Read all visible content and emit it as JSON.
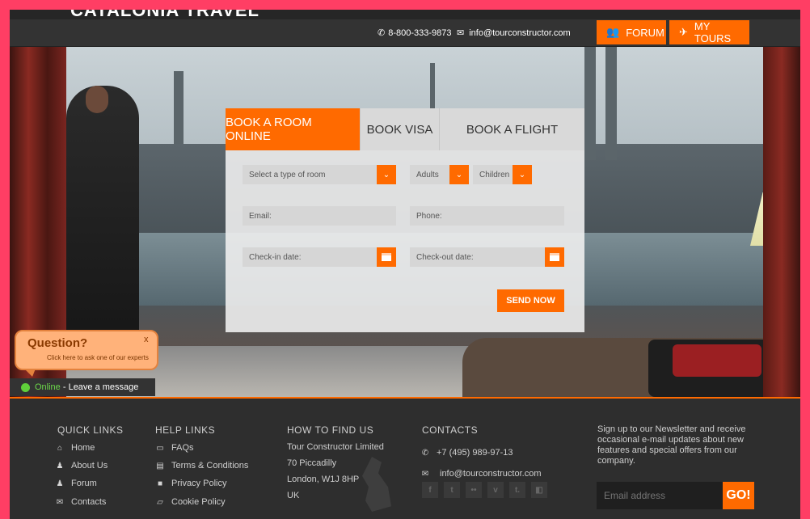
{
  "header": {
    "logo_text": "CATALONIA TRAVEL",
    "phone": "8-800-333-9873",
    "email": "info@tourconstructor.com",
    "forum_label": "FORUM",
    "tours_label": "MY TOURS"
  },
  "booking": {
    "tabs": [
      {
        "label": "BOOK A ROOM ONLINE",
        "active": true
      },
      {
        "label": "BOOK VISA",
        "active": false
      },
      {
        "label": "BOOK A FLIGHT",
        "active": false
      }
    ],
    "room_type_placeholder": "Select a type of room",
    "adults_placeholder": "Adults",
    "children_placeholder": "Children",
    "email_placeholder": "Email:",
    "phone_placeholder": "Phone:",
    "checkin_placeholder": "Check-in date:",
    "checkout_placeholder": "Check-out date:",
    "send_label": "SEND NOW"
  },
  "chat": {
    "question_title": "Question?",
    "close_label": "x",
    "question_sub": "Click here to ask one of our experts",
    "online_label": "Online",
    "leave_message": " - Leave a message"
  },
  "footer": {
    "quick_links": {
      "title": "QUICK LINKS",
      "items": [
        {
          "label": "Home",
          "icon": "home-icon"
        },
        {
          "label": "About Us",
          "icon": "user-icon"
        },
        {
          "label": "Forum",
          "icon": "users-icon"
        },
        {
          "label": "Contacts",
          "icon": "mail-icon"
        }
      ]
    },
    "help_links": {
      "title": "HELP LINKS",
      "items": [
        {
          "label": "FAQs",
          "icon": "chat-icon"
        },
        {
          "label": "Terms & Conditions",
          "icon": "document-icon"
        },
        {
          "label": "Privacy Policy",
          "icon": "lock-icon"
        },
        {
          "label": "Cookie Policy",
          "icon": "folder-icon"
        }
      ]
    },
    "find_us": {
      "title": "HOW TO FIND US",
      "lines": [
        "Tour Constructor Limited",
        "70 Piccadilly",
        "London, W1J 8HP",
        "UK"
      ]
    },
    "contacts": {
      "title": "CONTACTS",
      "phone": "+7 (495) 989-97-13",
      "email": "info@tourconstructor.com"
    },
    "newsletter": {
      "text": "Sign up to our Newsletter and receive occasional e-mail updates about new features and special offers from our company.",
      "input_placeholder": "Email address",
      "go_label": "GO!"
    }
  },
  "colors": {
    "accent": "#ff6a00",
    "frame": "#ff3e64",
    "footer_bg": "#2e2e2e"
  }
}
